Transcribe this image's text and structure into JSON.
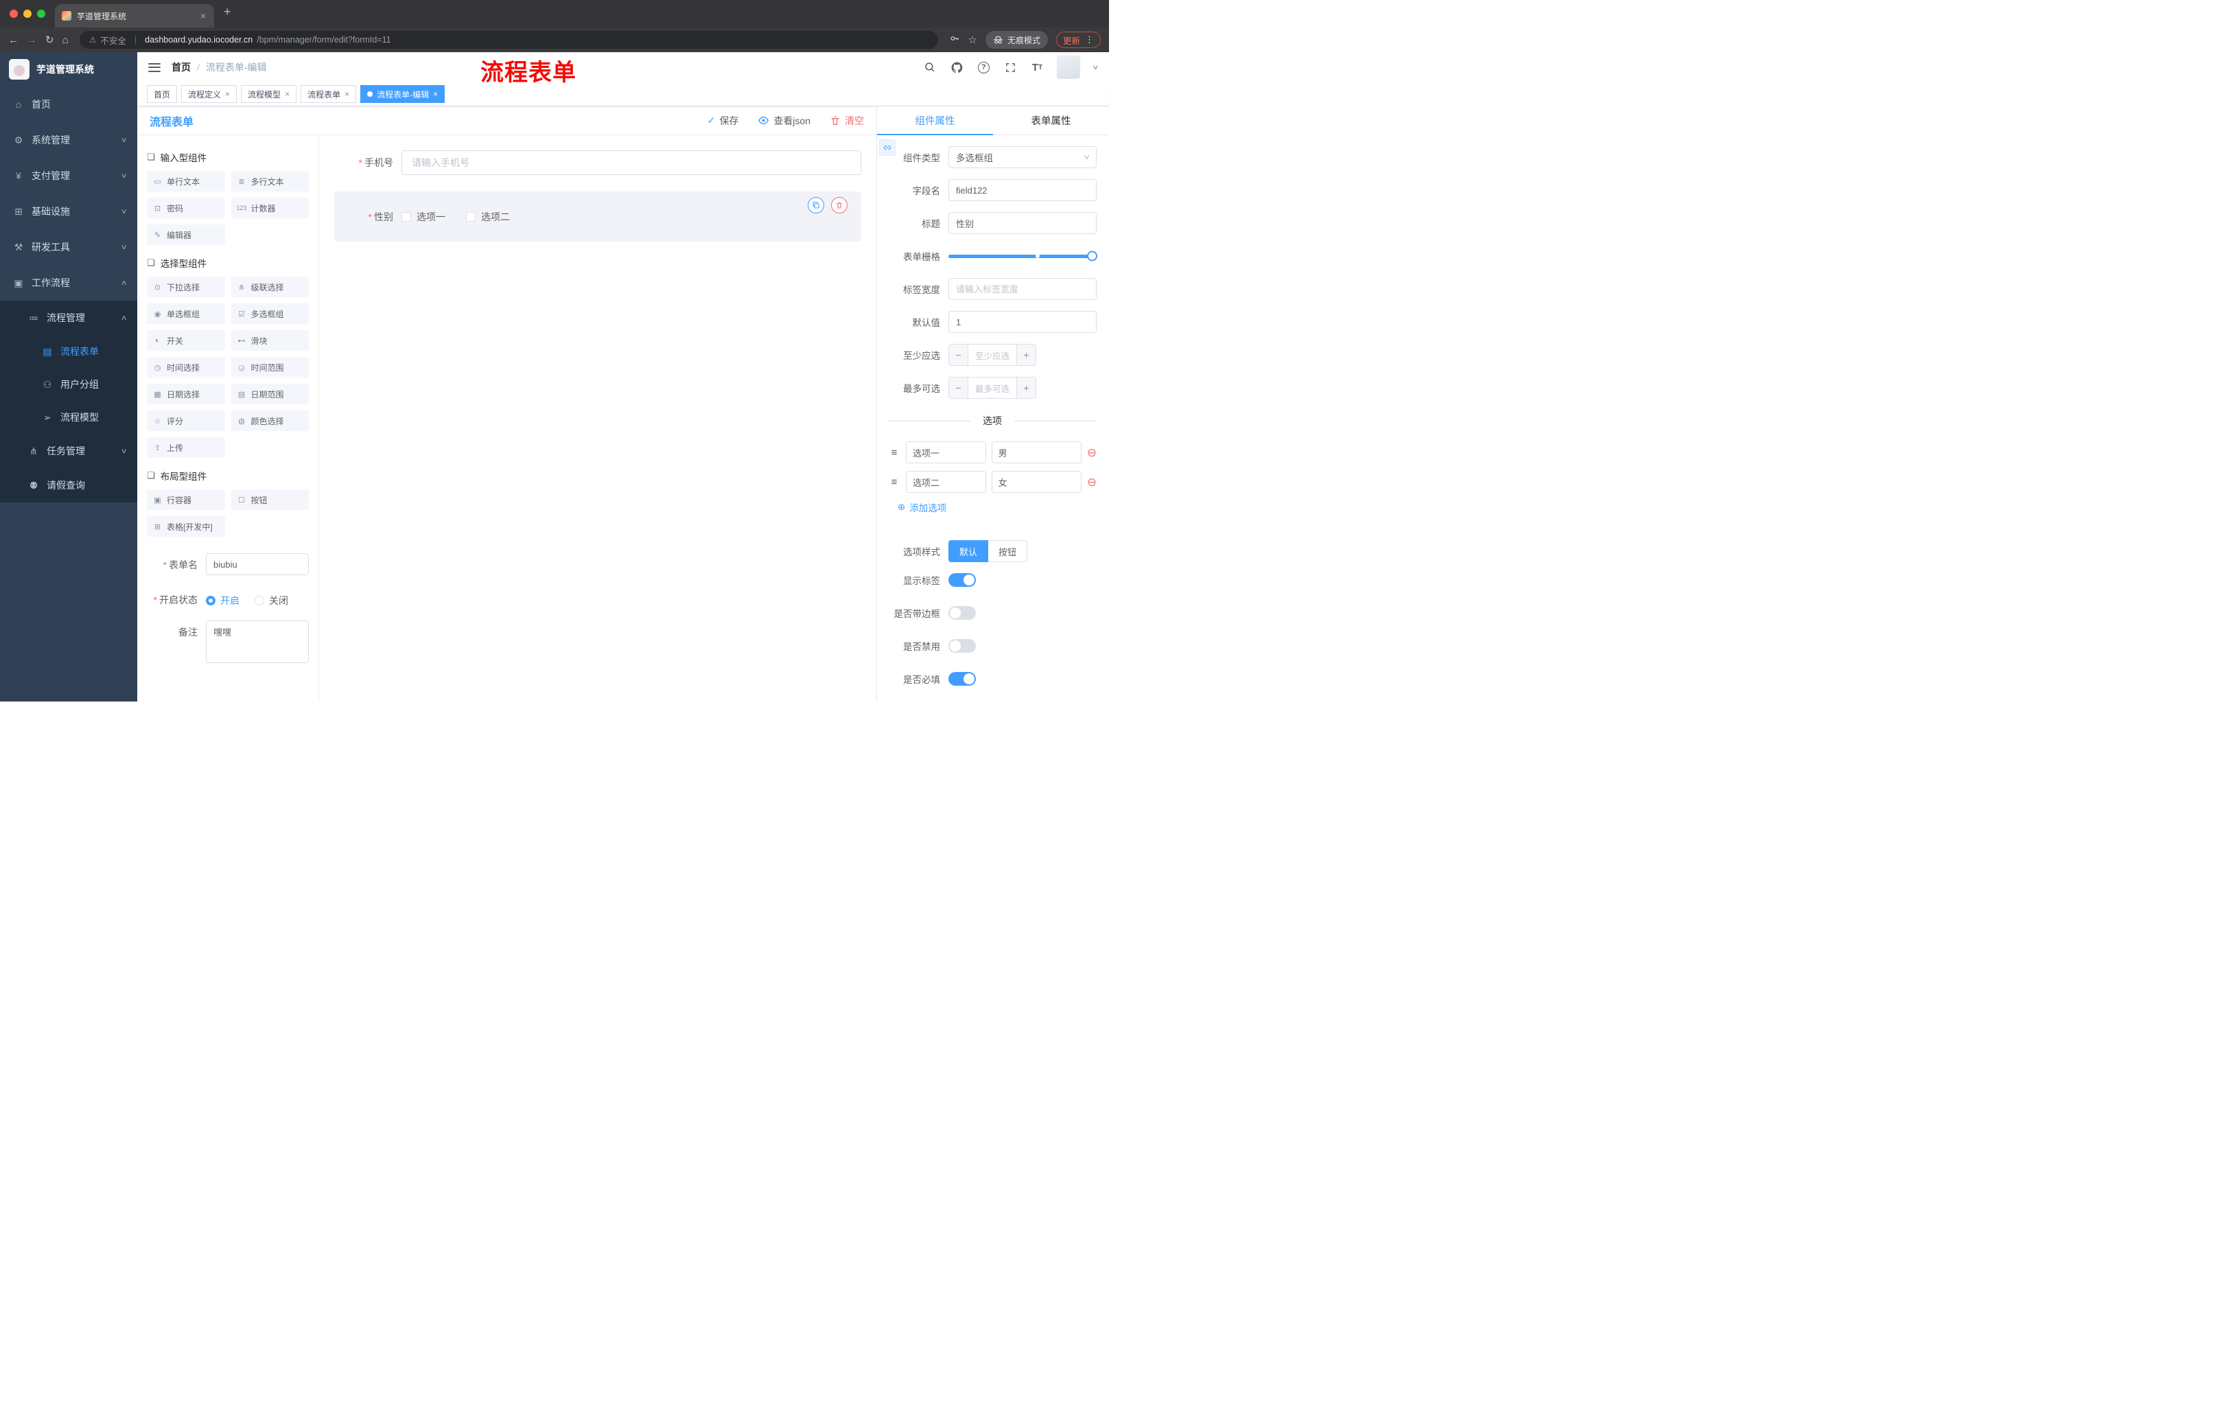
{
  "icons": {
    "close": "×",
    "new_tab": "+",
    "back": "←",
    "forward": "→",
    "reload": "↻",
    "home": "⌂",
    "warning": "⚠",
    "pipe": "|",
    "star": "☆",
    "dots": "⋮",
    "check": "✓",
    "required": "*",
    "breadcrumb_sep": "/",
    "question": "?",
    "chevron_down": "∨",
    "chevron_up": "∧",
    "minus": "−",
    "plus": "+",
    "minus_circle": "⊖",
    "plus_circle": "⊕",
    "option_handle": "≡",
    "tag_close": "×"
  },
  "browser": {
    "tab_title": "芋道管理系统",
    "security_label": "不安全",
    "url_host": "dashboard.yudao.iocoder.cn",
    "url_path": "/bpm/manager/form/edit?formId=11",
    "incognito_label": "无痕模式",
    "update_label": "更新"
  },
  "sidebar": {
    "logo_title": "芋道管理系统",
    "items": [
      {
        "icon": "⌂",
        "label": "首页"
      },
      {
        "icon": "⚙",
        "label": "系统管理"
      },
      {
        "icon": "¥",
        "label": "支付管理"
      },
      {
        "icon": "⊞",
        "label": "基础设施"
      },
      {
        "icon": "⚒",
        "label": "研发工具"
      },
      {
        "icon": "▣",
        "label": "工作流程"
      },
      {
        "icon": "≔",
        "label": "流程管理"
      },
      {
        "icon": "▤",
        "label": "流程表单"
      },
      {
        "icon": "⚇",
        "label": "用户分组"
      },
      {
        "icon": "➢",
        "label": "流程模型"
      },
      {
        "icon": "⋔",
        "label": "任务管理"
      },
      {
        "icon": "⚉",
        "label": "请假查询"
      }
    ]
  },
  "navbar": {
    "breadcrumb_home": "首页",
    "breadcrumb_current": "流程表单-编辑",
    "annotation": "流程表单"
  },
  "tags": [
    {
      "label": "首页"
    },
    {
      "label": "流程定义"
    },
    {
      "label": "流程模型"
    },
    {
      "label": "流程表单"
    },
    {
      "label": "流程表单-编辑"
    }
  ],
  "toolbar": {
    "title": "流程表单",
    "save_label": "保存",
    "view_json_label": "查看json",
    "clear_label": "清空"
  },
  "palette": {
    "sections": [
      {
        "title": "输入型组件",
        "items": [
          {
            "icon": "▭",
            "label": "单行文本"
          },
          {
            "icon": "≣",
            "label": "多行文本"
          },
          {
            "icon": "⊡",
            "label": "密码"
          },
          {
            "icon": "123",
            "label": "计数器"
          },
          {
            "icon": "✎",
            "label": "编辑器"
          }
        ]
      },
      {
        "title": "选择型组件",
        "items": [
          {
            "icon": "⊙",
            "label": "下拉选择"
          },
          {
            "icon": "⋔",
            "label": "级联选择"
          },
          {
            "icon": "◉",
            "label": "单选框组"
          },
          {
            "icon": "☑",
            "label": "多选框组"
          },
          {
            "icon": "◐",
            "label": "开关"
          },
          {
            "icon": "⊷",
            "label": "滑块"
          },
          {
            "icon": "◷",
            "label": "时间选择"
          },
          {
            "icon": "◶",
            "label": "时间范围"
          },
          {
            "icon": "▦",
            "label": "日期选择"
          },
          {
            "icon": "▤",
            "label": "日期范围"
          },
          {
            "icon": "☆",
            "label": "评分"
          },
          {
            "icon": "◍",
            "label": "颜色选择"
          },
          {
            "icon": "⇪",
            "label": "上传"
          }
        ]
      },
      {
        "title": "布局型组件",
        "items": [
          {
            "icon": "▣",
            "label": "行容器"
          },
          {
            "icon": "☐",
            "label": "按钮"
          },
          {
            "icon": "⊞",
            "label": "表格[开发中]"
          }
        ]
      }
    ],
    "section_icon": "❏",
    "form": {
      "name_label": "表单名",
      "name_value": "biubiu",
      "status_label": "开启状态",
      "status_on": "开启",
      "status_off": "关闭",
      "remark_label": "备注",
      "remark_value": "嘿嘿"
    }
  },
  "canvas": {
    "phone_label": "手机号",
    "phone_placeholder": "请输入手机号",
    "gender_label": "性别",
    "gender_option1": "选项一",
    "gender_option2": "选项二"
  },
  "props": {
    "tab_component": "组件属性",
    "tab_form": "表单属性",
    "component_type_label": "组件类型",
    "component_type_value": "多选框组",
    "field_name_label": "字段名",
    "field_name_value": "field122",
    "title_label": "标题",
    "title_value": "性别",
    "grid_label": "表单栅格",
    "label_width_label": "标签宽度",
    "label_width_placeholder": "请输入标签宽度",
    "default_label": "默认值",
    "default_value": "1",
    "min_label": "至少应选",
    "min_placeholder": "至少应选",
    "max_label": "最多可选",
    "max_placeholder": "最多可选",
    "options_divider": "选项",
    "options": [
      {
        "label": "选项一",
        "value": "男"
      },
      {
        "label": "选项二",
        "value": "女"
      }
    ],
    "add_option_label": "添加选项",
    "style_label": "选项样式",
    "style_default": "默认",
    "style_button": "按钮",
    "toggle_show_label": "显示标签",
    "toggle_border_label": "是否带边框",
    "toggle_disabled_label": "是否禁用",
    "toggle_required_label": "是否必填"
  },
  "colors": {
    "primary": "#409eff",
    "danger": "#f56c6c",
    "sidebar_bg": "#304156",
    "submenu_bg": "#1f2d3d",
    "annotation_red": "#f90804"
  }
}
